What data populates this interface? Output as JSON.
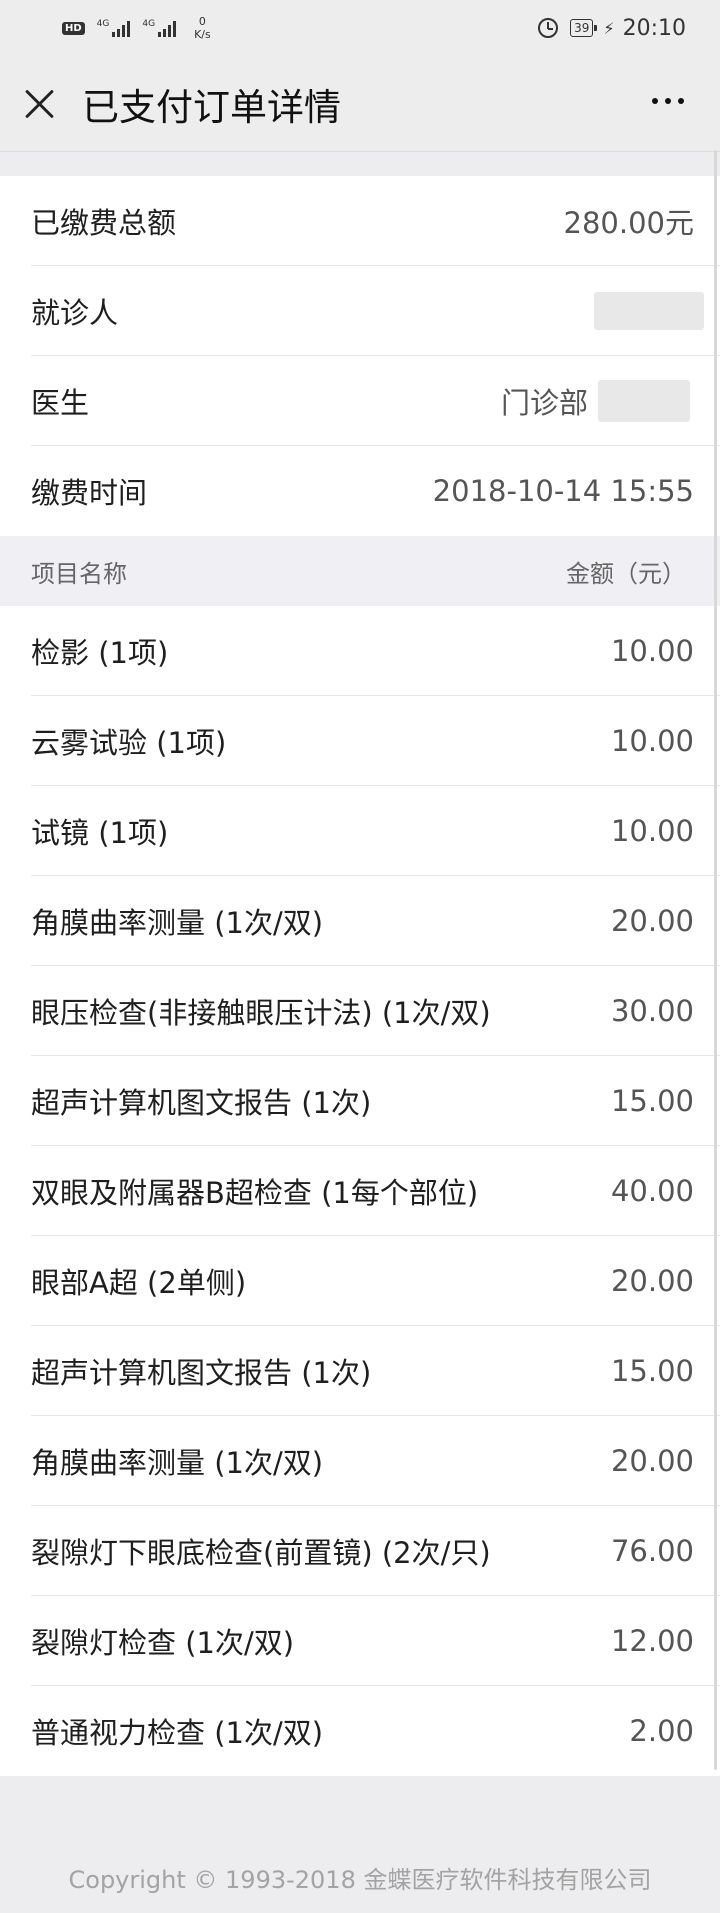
{
  "status_bar": {
    "hd": "HD",
    "signal1": "4G",
    "signal2": "4G",
    "net_speed_value": "0",
    "net_speed_unit": "K/s",
    "battery": "39",
    "time": "20:10"
  },
  "nav": {
    "title": "已支付订单详情"
  },
  "summary": {
    "total_label": "已缴费总额",
    "total_value": "280.00元",
    "patient_label": "就诊人",
    "doctor_label": "医生",
    "doctor_dept": "门诊部",
    "time_label": "缴费时间",
    "time_value": "2018-10-14 15:55"
  },
  "table": {
    "col_name": "项目名称",
    "col_amount": "金额（元）",
    "items": [
      {
        "name": "检影 (1项)",
        "amount": "10.00"
      },
      {
        "name": "云雾试验 (1项)",
        "amount": "10.00"
      },
      {
        "name": "试镜 (1项)",
        "amount": "10.00"
      },
      {
        "name": "角膜曲率测量 (1次/双)",
        "amount": "20.00"
      },
      {
        "name": "眼压检查(非接触眼压计法) (1次/双)",
        "amount": "30.00"
      },
      {
        "name": "超声计算机图文报告 (1次)",
        "amount": "15.00"
      },
      {
        "name": "双眼及附属器B超检查 (1每个部位)",
        "amount": "40.00"
      },
      {
        "name": "眼部A超 (2单侧)",
        "amount": "20.00"
      },
      {
        "name": "超声计算机图文报告 (1次)",
        "amount": "15.00"
      },
      {
        "name": "角膜曲率测量 (1次/双)",
        "amount": "20.00"
      },
      {
        "name": "裂隙灯下眼底检查(前置镜) (2次/只)",
        "amount": "76.00"
      },
      {
        "name": "裂隙灯检查 (1次/双)",
        "amount": "12.00"
      },
      {
        "name": "普通视力检查 (1次/双)",
        "amount": "2.00"
      }
    ]
  },
  "footer": {
    "copyright": "Copyright © 1993-2018 金蝶医疗软件科技有限公司"
  }
}
